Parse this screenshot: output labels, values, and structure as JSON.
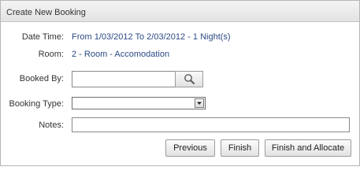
{
  "panel": {
    "title": "Create New Booking"
  },
  "form": {
    "date_time": {
      "label": "Date Time:",
      "value": "From 1/03/2012 To 2/03/2012 - 1 Night(s)"
    },
    "room": {
      "label": "Room:",
      "value": "2 - Room - Accomodation"
    },
    "booked_by": {
      "label": "Booked By:",
      "value": "",
      "search_icon": "magnifier-icon"
    },
    "booking_type": {
      "label": "Booking Type:",
      "selected": "",
      "arrow_icon": "chevron-down-icon"
    },
    "notes": {
      "label": "Notes:",
      "value": ""
    }
  },
  "buttons": {
    "previous": "Previous",
    "finish": "Finish",
    "finish_and_allocate": "Finish and Allocate"
  },
  "colors": {
    "value_text": "#2b4a84",
    "header_bg": "#e8e8e8",
    "border": "#b5b5b5"
  }
}
